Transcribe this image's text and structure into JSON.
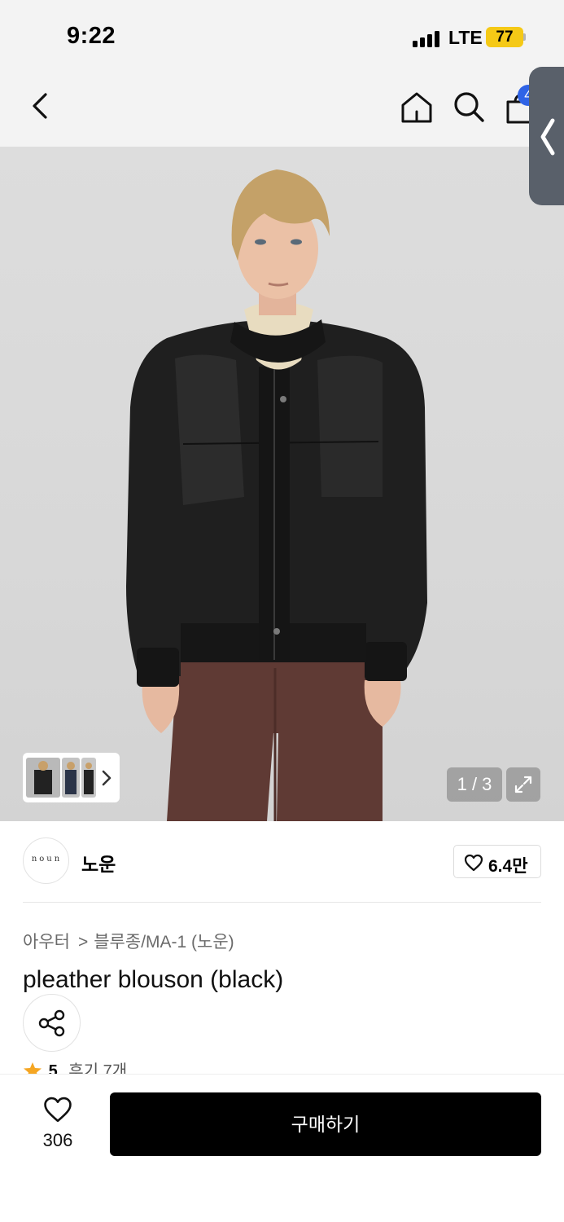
{
  "status_bar": {
    "time": "9:22",
    "network": "LTE",
    "battery": "77",
    "battery_color": "#f5c916"
  },
  "nav": {
    "icons": [
      "back-icon",
      "home-icon",
      "search-icon",
      "cart-icon"
    ],
    "cart_badge": "4",
    "badge_color": "#2f63e6"
  },
  "gallery": {
    "counter": "1 / 3",
    "current_index": 1,
    "total": 3
  },
  "brand": {
    "logo_text": "noun",
    "name": "노운",
    "likes": "6.4만"
  },
  "product": {
    "breadcrumb": [
      "아우터",
      "블루종/MA-1 (노운)"
    ],
    "breadcrumb_separator": ">",
    "title": "pleather blouson (black)",
    "rating": "5",
    "review_count": "후기 7개",
    "star_color": "#f5a623"
  },
  "bottom_bar": {
    "wish_count": "306",
    "buy_label": "구매하기"
  }
}
